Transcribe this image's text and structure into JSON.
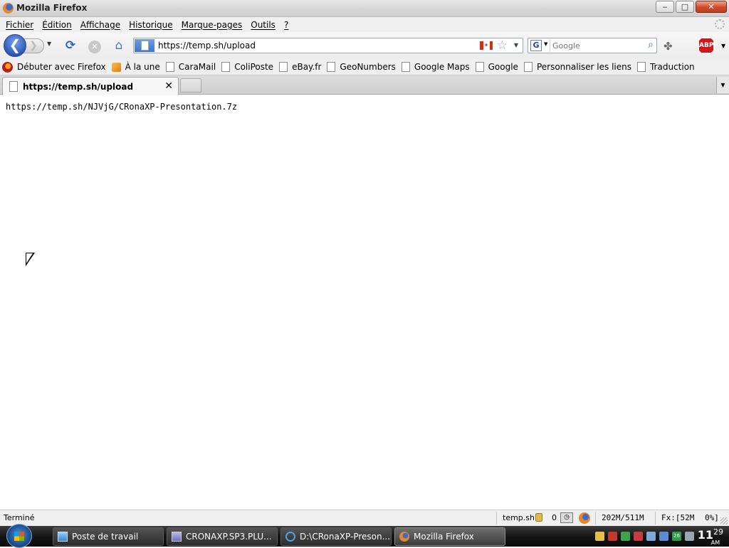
{
  "window": {
    "title": "Mozilla Firefox",
    "controls": {
      "minimize": "‒",
      "maximize": "□",
      "close": "✕"
    }
  },
  "menu": [
    "Fichier",
    "Édition",
    "Affichage",
    "Historique",
    "Marque-pages",
    "Outils",
    "?"
  ],
  "navbar": {
    "back_glyph": "❮",
    "forward_glyph": "❯",
    "url": "https://temp.sh/upload",
    "search_placeholder": "Google",
    "search_engine_letter": "G",
    "adblock_label": "ABP",
    "flag_maple": "✦",
    "icons": [
      "back-icon",
      "forward-icon",
      "reload-icon",
      "stop-icon",
      "home-icon",
      "bookmark-star-icon",
      "magnifier-icon",
      "addon-icon",
      "adblock-icon"
    ]
  },
  "bookmarks": [
    {
      "label": "Débuter avec Firefox",
      "icon": "firefox-icon"
    },
    {
      "label": "À la une",
      "icon": "rss-icon"
    },
    {
      "label": "CaraMail",
      "icon": "page-icon"
    },
    {
      "label": "ColiPoste",
      "icon": "page-icon"
    },
    {
      "label": "eBay.fr",
      "icon": "page-icon"
    },
    {
      "label": "GeoNumbers",
      "icon": "page-icon"
    },
    {
      "label": "Google Maps",
      "icon": "page-icon"
    },
    {
      "label": "Google",
      "icon": "page-icon"
    },
    {
      "label": "Personnaliser les liens",
      "icon": "page-icon"
    },
    {
      "label": "Traduction",
      "icon": "page-icon"
    }
  ],
  "tabs": [
    {
      "title": "https://temp.sh/upload",
      "active": true
    }
  ],
  "content": {
    "text": "https://temp.sh/NJVjG/CRonaXP-Presontation.7z"
  },
  "statusbar": {
    "status": "Terminé",
    "domain": "temp.sh",
    "count": "0",
    "memory": "202M/511M",
    "fx": "Fx:[52M",
    "percent": "0%]"
  },
  "taskbar": {
    "tasks": [
      {
        "label": "Poste de travail",
        "icon": "computer-icon",
        "active": false
      },
      {
        "label": "CRONAXP.SP3.PLU...",
        "icon": "archive-icon",
        "active": false
      },
      {
        "label": "D:\\CRonaXP-Preson...",
        "icon": "ie-icon",
        "active": false
      },
      {
        "label": "Mozilla Firefox",
        "icon": "firefox-icon",
        "active": true
      }
    ],
    "clock_hour": "11",
    "clock_minute": "29",
    "clock_ampm": "AM",
    "tray_badge": "26"
  },
  "colors": {
    "titlebar": "#d8d8d8",
    "back_button": "#2a57b8",
    "taskbar": "#161616",
    "abp_red": "#d01818"
  }
}
